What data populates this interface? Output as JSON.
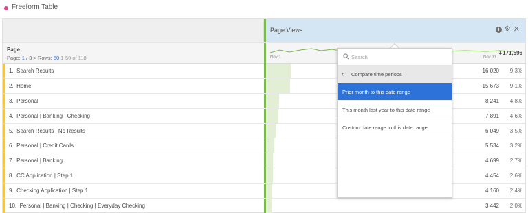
{
  "panel": {
    "title": "Freeform Table"
  },
  "metric": {
    "label": "Page Views",
    "total": "171,596",
    "trend_start": "Nov 1",
    "trend_end": "Nov 31"
  },
  "dimension": {
    "label": "Page",
    "pager_prefix": "Page:",
    "page_current": "1",
    "page_sep": "/",
    "page_total": "3",
    "rows_prefix": "Rows:",
    "rows_value": "50",
    "rows_range": "1-50 of 118"
  },
  "rows": [
    {
      "rank": "1.",
      "label": "Search Results",
      "value": "16,020",
      "pct": "9.3%",
      "share": 0.093
    },
    {
      "rank": "2.",
      "label": "Home",
      "value": "15,673",
      "pct": "9.1%",
      "share": 0.091
    },
    {
      "rank": "3.",
      "label": "Personal",
      "value": "8,241",
      "pct": "4.8%",
      "share": 0.048
    },
    {
      "rank": "4.",
      "label": "Personal | Banking | Checking",
      "value": "7,891",
      "pct": "4.6%",
      "share": 0.046
    },
    {
      "rank": "5.",
      "label": "Search Results | No Results",
      "value": "6,049",
      "pct": "3.5%",
      "share": 0.035
    },
    {
      "rank": "6.",
      "label": "Personal | Credit Cards",
      "value": "5,534",
      "pct": "3.2%",
      "share": 0.032
    },
    {
      "rank": "7.",
      "label": "Personal | Banking",
      "value": "4,699",
      "pct": "2.7%",
      "share": 0.027
    },
    {
      "rank": "8.",
      "label": "CC Application | Step 1",
      "value": "4,454",
      "pct": "2.6%",
      "share": 0.026
    },
    {
      "rank": "9.",
      "label": "Checking Application | Step 1",
      "value": "4,160",
      "pct": "2.4%",
      "share": 0.024
    },
    {
      "rank": "10.",
      "label": "Personal | Banking | Checking | Everyday Checking",
      "value": "3,442",
      "pct": "2.0%",
      "share": 0.02
    }
  ],
  "popup": {
    "search_placeholder": "Search",
    "back_label": "Compare time periods",
    "options": [
      {
        "label": "Prior month to this date range",
        "selected": true
      },
      {
        "label": "This month last year to this date range",
        "selected": false
      },
      {
        "label": "Custom date range to this date range",
        "selected": false
      }
    ]
  },
  "colors": {
    "accent_blue": "#2d72d9",
    "metric_header": "#d4e5f4",
    "bar_fill": "#e3efd5",
    "metric_edge": "#7ab94f",
    "row_edge": "#f1c64a",
    "title_dot": "#d94a8c"
  },
  "icons": [
    "info-icon",
    "gear-icon",
    "close-icon",
    "sort-down-icon",
    "search-icon",
    "chevron-left-icon"
  ]
}
